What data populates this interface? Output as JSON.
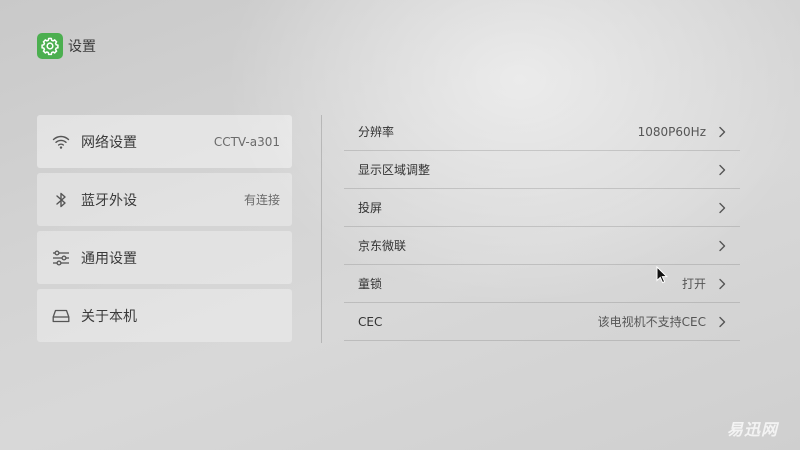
{
  "header": {
    "title": "设置",
    "icon": "gear-icon",
    "icon_color": "#4caf50"
  },
  "left_menu": {
    "items": [
      {
        "label": "网络设置",
        "value": "CCTV-a301",
        "icon": "wifi-icon"
      },
      {
        "label": "蓝牙外设",
        "value": "有连接",
        "icon": "bluetooth-icon"
      },
      {
        "label": "通用设置",
        "value": "",
        "icon": "sliders-icon"
      },
      {
        "label": "关于本机",
        "value": "",
        "icon": "device-icon"
      }
    ]
  },
  "right_list": {
    "rows": [
      {
        "label": "分辨率",
        "value": "1080P60Hz"
      },
      {
        "label": "显示区域调整",
        "value": ""
      },
      {
        "label": "投屏",
        "value": ""
      },
      {
        "label": "京东微联",
        "value": ""
      },
      {
        "label": "童锁",
        "value": "打开"
      },
      {
        "label": "CEC",
        "value": "该电视机不支持CEC"
      }
    ]
  },
  "watermark": "易迅网"
}
